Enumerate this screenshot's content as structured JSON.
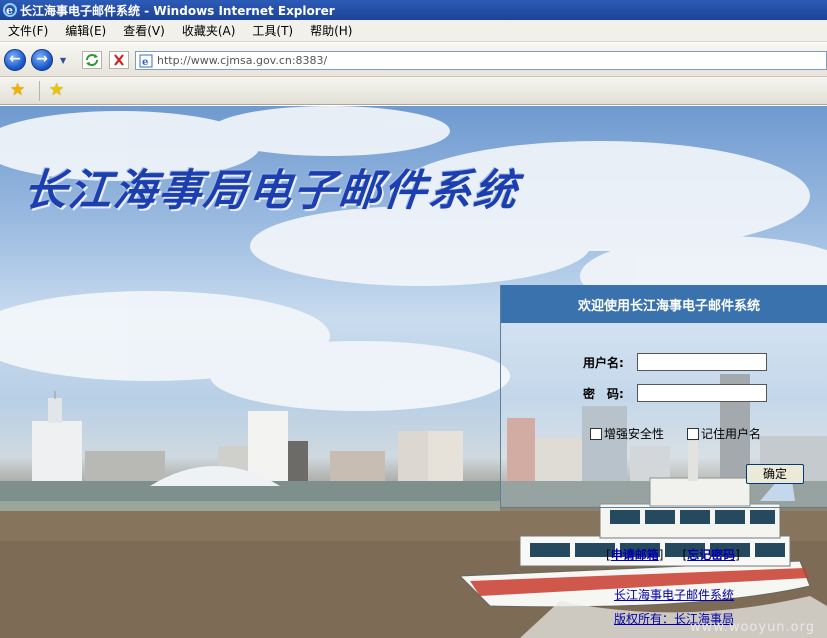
{
  "window": {
    "title": "长江海事电子邮件系统 - Windows Internet Explorer"
  },
  "menu": {
    "items": [
      "文件(F)",
      "编辑(E)",
      "查看(V)",
      "收藏夹(A)",
      "工具(T)",
      "帮助(H)"
    ]
  },
  "address": {
    "url": "http://www.cjmsa.gov.cn:8383/"
  },
  "page": {
    "banner": "长江海事局电子邮件系统",
    "login": {
      "heading": "欢迎使用长江海事电子邮件系统",
      "username_label": "用户名:",
      "password_label": "密　码:",
      "username_value": "",
      "password_value": "",
      "enhance_security_label": "增强安全性",
      "remember_user_label": "记住用户名",
      "submit_label": "确定"
    },
    "links": {
      "apply_mailbox": "申请邮箱",
      "forgot_password": "忘记密码"
    },
    "footer": {
      "system_name": "长江海事电子邮件系统",
      "copyright": "版权所有：长江海事局"
    },
    "watermark": "www.wooyun.org"
  },
  "colors": {
    "titlebar": "#1d4396",
    "login_header": "#3a72ad",
    "banner_text": "#1c3fb0",
    "link": "#0000aa"
  }
}
